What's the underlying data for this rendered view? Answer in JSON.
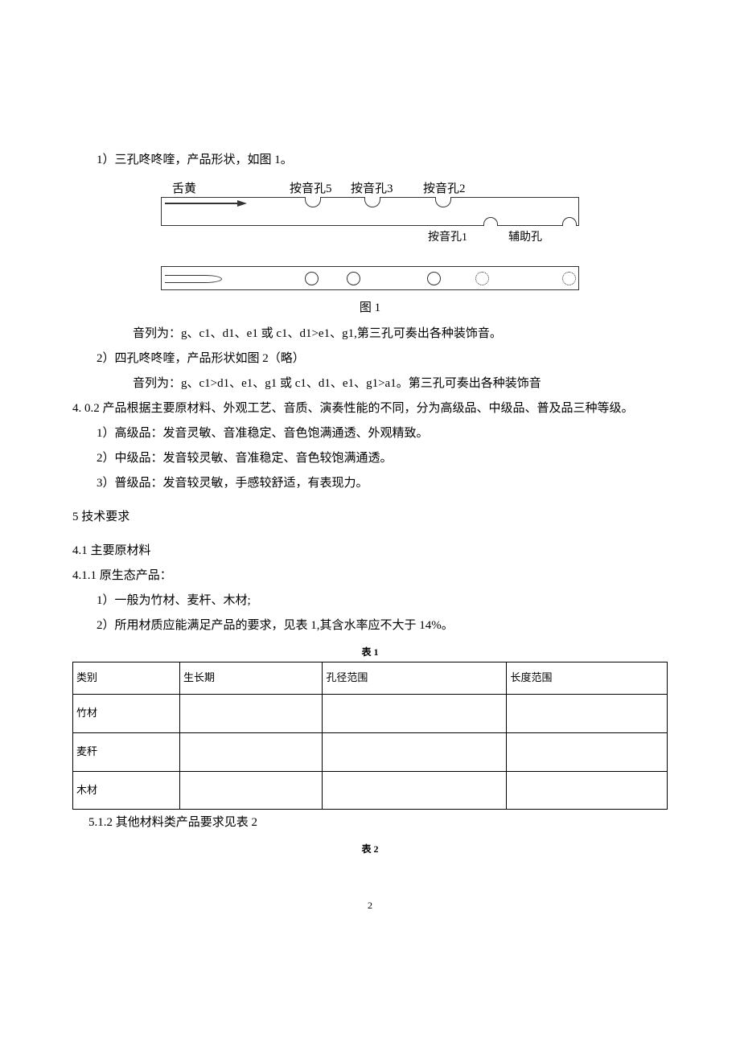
{
  "line1": "1）三孔咚咚喹，产品形状，如图 1。",
  "fig": {
    "label_reed": "舌黄",
    "label_h5": "按音孔5",
    "label_h3": "按音孔3",
    "label_h2": "按音孔2",
    "label_h1": "按音孔1",
    "label_aux": "辅助孔",
    "caption": "图 1"
  },
  "line_seq1": "音列为：g、c1、d1、e1 或 c1、d1>e1、g1,第三孔可奏出各种装饰音。",
  "line2": "2）四孔咚咚喹，产品形状如图 2（略）",
  "line_seq2": "音列为：g、c1>d1、e1、g1 或 c1、d1、e1、g1>a1。第三孔可奏出各种装饰音",
  "line_4_0_2": "4.  0.2 产品根据主要原材料、外观工艺、音质、演奏性能的不同，分为高级品、中级品、普及品三种等级。",
  "grade1": "1）高级品：发音灵敏、音准稳定、音色饱满通透、外观精致。",
  "grade2": "2）中级品：发音较灵敏、音准稳定、音色较饱满通透。",
  "grade3": "3）普级品：发音较灵敏，手感较舒适，有表现力。",
  "sec5": "5 技术要求",
  "sec4_1": "4.1   主要原材料",
  "sec4_1_1": "4.1.1  原生态产品：",
  "mat1": "1）一般为竹材、麦杆、木材;",
  "mat2": "2）所用材质应能满足产品的要求，见表 1,其含水率应不大于 14%。",
  "table1_caption": "表 1",
  "table1": {
    "headers": [
      "类别",
      "生长期",
      "孔径范围",
      "长度范围"
    ],
    "rows": [
      [
        "竹材",
        "",
        "",
        ""
      ],
      [
        "麦秆",
        "",
        "",
        ""
      ],
      [
        "木材",
        "",
        "",
        ""
      ]
    ]
  },
  "line_5_1_2": "5.1.2 其他材料类产品要求见表 2",
  "table2_caption": "表 2",
  "page_num": "2"
}
